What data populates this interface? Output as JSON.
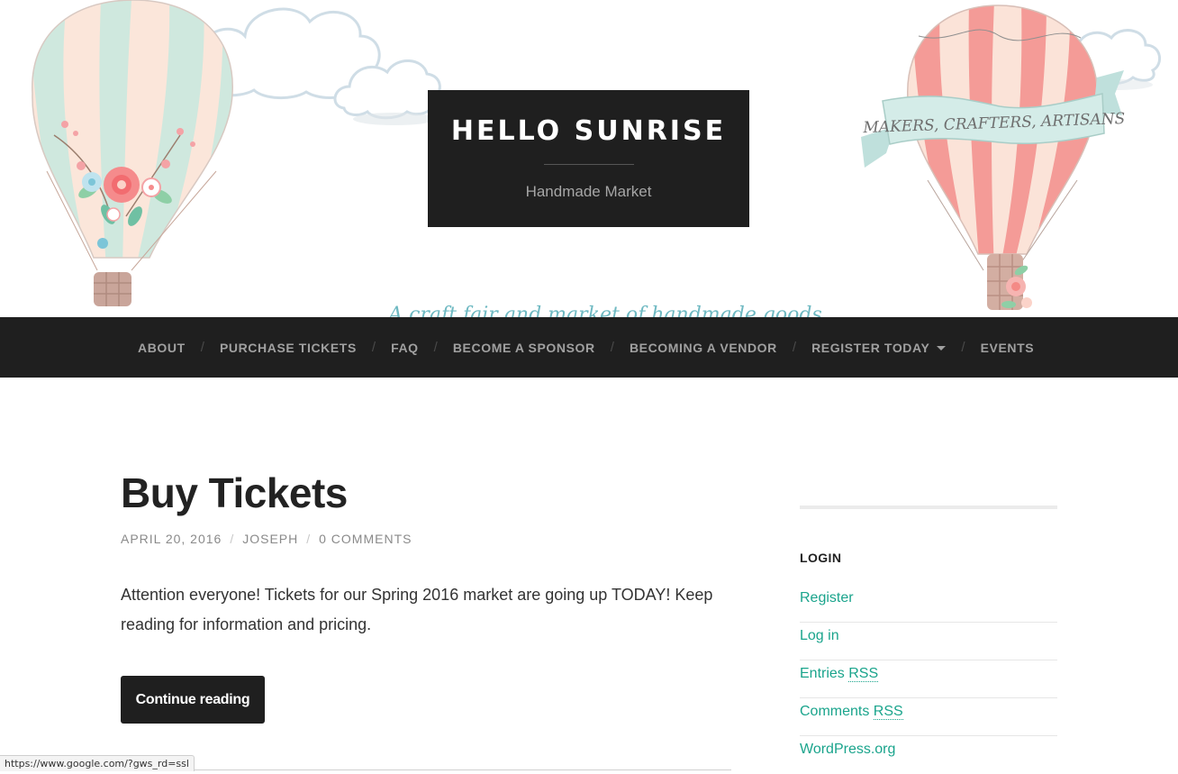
{
  "header": {
    "title": "HELLO SUNRISE",
    "tagline": "Handmade Market",
    "banner_text": "MAKERS, CRAFTERS, ARTISANS",
    "script_text": "A craft fair and market of handmade goods",
    "colors": {
      "box": "#1f1f1f",
      "mint": "#cfe8de",
      "peach": "#fbe6da",
      "coral": "#f49b97",
      "cloud": "#ffffff"
    }
  },
  "nav": {
    "items": [
      {
        "label": "About"
      },
      {
        "label": "Purchase Tickets"
      },
      {
        "label": "FAQ"
      },
      {
        "label": "Become a Sponsor"
      },
      {
        "label": "Becoming a Vendor"
      },
      {
        "label": "Register Today",
        "has_dropdown": true
      },
      {
        "label": "Events"
      }
    ],
    "separator": "/"
  },
  "post": {
    "title": "Buy Tickets",
    "meta": {
      "date": "April 20, 2016",
      "author": "Joseph",
      "comments": "0 Comments",
      "separator": "/"
    },
    "excerpt": "Attention everyone! Tickets for our Spring 2016 market are going up TODAY! Keep reading for information and pricing.",
    "continue_label": "Continue reading"
  },
  "sidebar": {
    "widget_title": "Login",
    "links": {
      "register": "Register",
      "login": "Log in",
      "entries_prefix": "Entries ",
      "comments_prefix": "Comments ",
      "rss": "RSS",
      "wordpress": "WordPress.org"
    },
    "link_color": "#1aa48c"
  },
  "status_bar": {
    "url": "https://www.google.com/?gws_rd=ssl"
  }
}
